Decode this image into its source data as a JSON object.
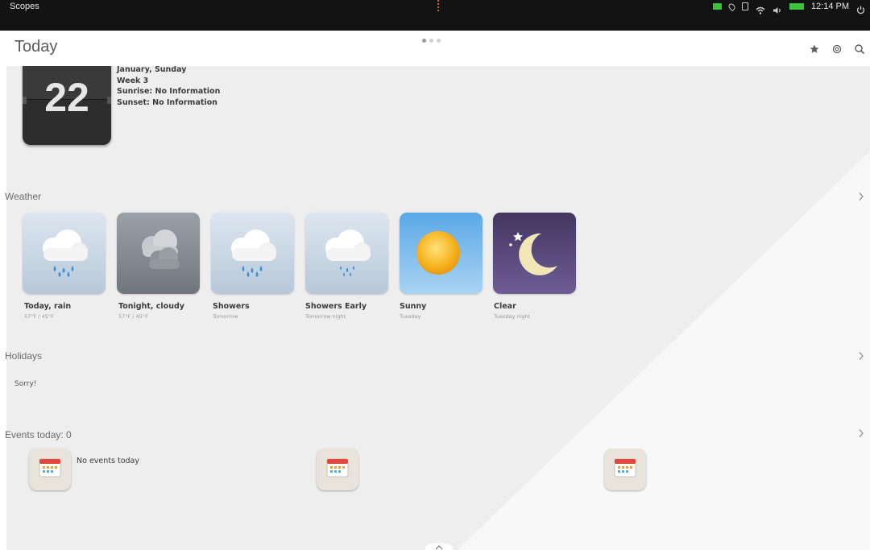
{
  "status_bar": {
    "app_name": "Scopes",
    "time": "12:14 PM",
    "icons": [
      "message-icon",
      "location-icon",
      "sim-icon",
      "wifi-icon",
      "volume-icon",
      "battery-icon",
      "power-icon"
    ]
  },
  "header": {
    "title": "Today",
    "actions": [
      "star-icon",
      "settings-icon",
      "search-icon"
    ]
  },
  "pager": {
    "count": 3,
    "active": 0
  },
  "date_card": {
    "day": "22",
    "line1": "January, Sunday",
    "line2": "Week 3",
    "sunrise": "Sunrise: No Information",
    "sunset": "Sunset: No Information"
  },
  "weather": {
    "label": "Weather",
    "items": [
      {
        "name": "Today, rain",
        "sub": "57°F / 45°F",
        "icon": "rain-cloud-icon"
      },
      {
        "name": "Tonight, cloudy",
        "sub": "57°F / 45°F",
        "icon": "cloudy-icon"
      },
      {
        "name": "Showers",
        "sub": "Tomorrow",
        "icon": "showers-icon"
      },
      {
        "name": "Showers Early",
        "sub": "Tomorrow night",
        "icon": "showers-early-icon"
      },
      {
        "name": "Sunny",
        "sub": "Tuesday",
        "icon": "sun-icon"
      },
      {
        "name": "Clear",
        "sub": "Tuesday night",
        "icon": "moon-icon"
      }
    ]
  },
  "holidays": {
    "label": "Holidays",
    "text": "Sorry!"
  },
  "events": {
    "label": "Events today: 0",
    "text": "No events today"
  },
  "colors": {
    "status_bar_bg": "#131313",
    "indicator_green": "#3dc23d",
    "notification_orange": "#e0602b",
    "calendar_dark": "#2d2d2d",
    "sunny_sky": "#5aa8e6",
    "night_purple": "#5a4a7e"
  }
}
